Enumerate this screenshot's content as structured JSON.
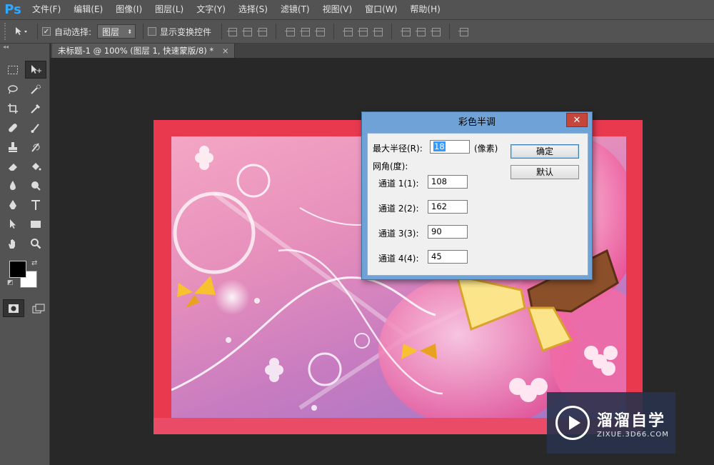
{
  "app": {
    "logo": "Ps"
  },
  "menu": [
    "文件(F)",
    "编辑(E)",
    "图像(I)",
    "图层(L)",
    "文字(Y)",
    "选择(S)",
    "滤镜(T)",
    "视图(V)",
    "窗口(W)",
    "帮助(H)"
  ],
  "options": {
    "auto_select_label": "自动选择:",
    "auto_select_value": "图层",
    "show_transform_label": "显示变换控件"
  },
  "document_tab": {
    "title": "未标题-1 @ 100% (图层 1, 快速蒙版/8) *",
    "close": "×"
  },
  "toolbar": {
    "collapse": "◂◂"
  },
  "colors": {
    "foreground": "#000000",
    "background": "#ffffff"
  },
  "dialog": {
    "title": "彩色半调",
    "close": "✕",
    "max_radius_label": "最大半径(R):",
    "max_radius_value": "18",
    "unit": "(像素)",
    "screen_angles_label": "网角(度):",
    "channels": [
      {
        "label": "通道 1(1):",
        "value": "108"
      },
      {
        "label": "通道 2(2):",
        "value": "162"
      },
      {
        "label": "通道 3(3):",
        "value": "90"
      },
      {
        "label": "通道 4(4):",
        "value": "45"
      }
    ],
    "ok_label": "确定",
    "default_label": "默认"
  },
  "watermark": {
    "name": "溜溜自学",
    "url": "ZIXUE.3D66.COM"
  }
}
